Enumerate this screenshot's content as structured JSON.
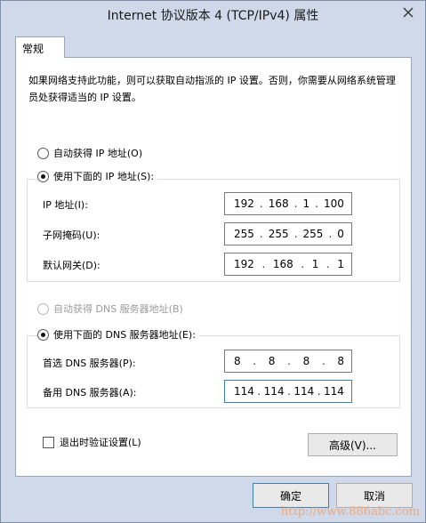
{
  "window": {
    "title": "Internet 协议版本 4 (TCP/IPv4) 属性"
  },
  "tabs": [
    {
      "label": "常规"
    }
  ],
  "intro_text": "如果网络支持此功能，则可以获取自动指派的 IP 设置。否则，你需要从网络系统管理员处获得适当的 IP 设置。",
  "ip_section": {
    "auto_label": "自动获得 IP 地址(O)",
    "manual_label": "使用下面的 IP 地址(S):",
    "fields": [
      {
        "label": "IP 地址(I):",
        "value": [
          "192",
          "168",
          "1",
          "100"
        ]
      },
      {
        "label": "子网掩码(U):",
        "value": [
          "255",
          "255",
          "255",
          "0"
        ]
      },
      {
        "label": "默认网关(D):",
        "value": [
          "192",
          "168",
          "1",
          "1"
        ]
      }
    ]
  },
  "dns_section": {
    "auto_label": "自动获得 DNS 服务器地址(B)",
    "manual_label": "使用下面的 DNS 服务器地址(E):",
    "fields": [
      {
        "label": "首选 DNS 服务器(P):",
        "value": [
          "8",
          "8",
          "8",
          "8"
        ]
      },
      {
        "label": "备用 DNS 服务器(A):",
        "value": [
          "114",
          "114",
          "114",
          "114"
        ]
      }
    ]
  },
  "validate_label": "退出时验证设置(L)",
  "advanced_label": "高级(V)...",
  "ok_label": "确定",
  "cancel_label": "取消",
  "watermark": "http://www.886abc.com"
}
